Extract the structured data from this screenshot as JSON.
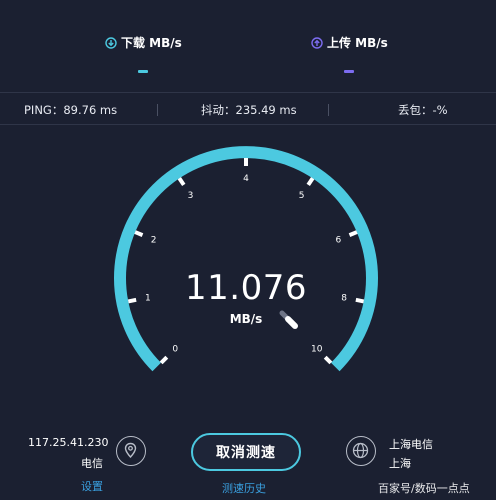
{
  "header": {
    "download": {
      "label": "下载 MB/s",
      "value": "–",
      "accent": "#4cc9e0"
    },
    "upload": {
      "label": "上传 MB/s",
      "value": "–",
      "accent": "#7c6cf0"
    }
  },
  "stats": {
    "ping": "PING：89.76 ms",
    "jitter": "抖动：235.49 ms",
    "loss": "丢包：-%"
  },
  "gauge": {
    "ticks": [
      "0",
      "1",
      "2",
      "3",
      "4",
      "5",
      "6",
      "8",
      "10"
    ],
    "value": "11.076",
    "unit": "MB/s",
    "arc_color": "#4cc9e0"
  },
  "footer": {
    "ip": "117.25.41.230",
    "isp": "电信",
    "settings_label": "设置",
    "cancel_label": "取消测速",
    "history_label": "测速历史",
    "server_name": "上海电信",
    "server_city": "上海",
    "location_icon": "location-pin-icon",
    "server_icon": "globe-icon"
  },
  "watermark": "百家号/数码一点点"
}
